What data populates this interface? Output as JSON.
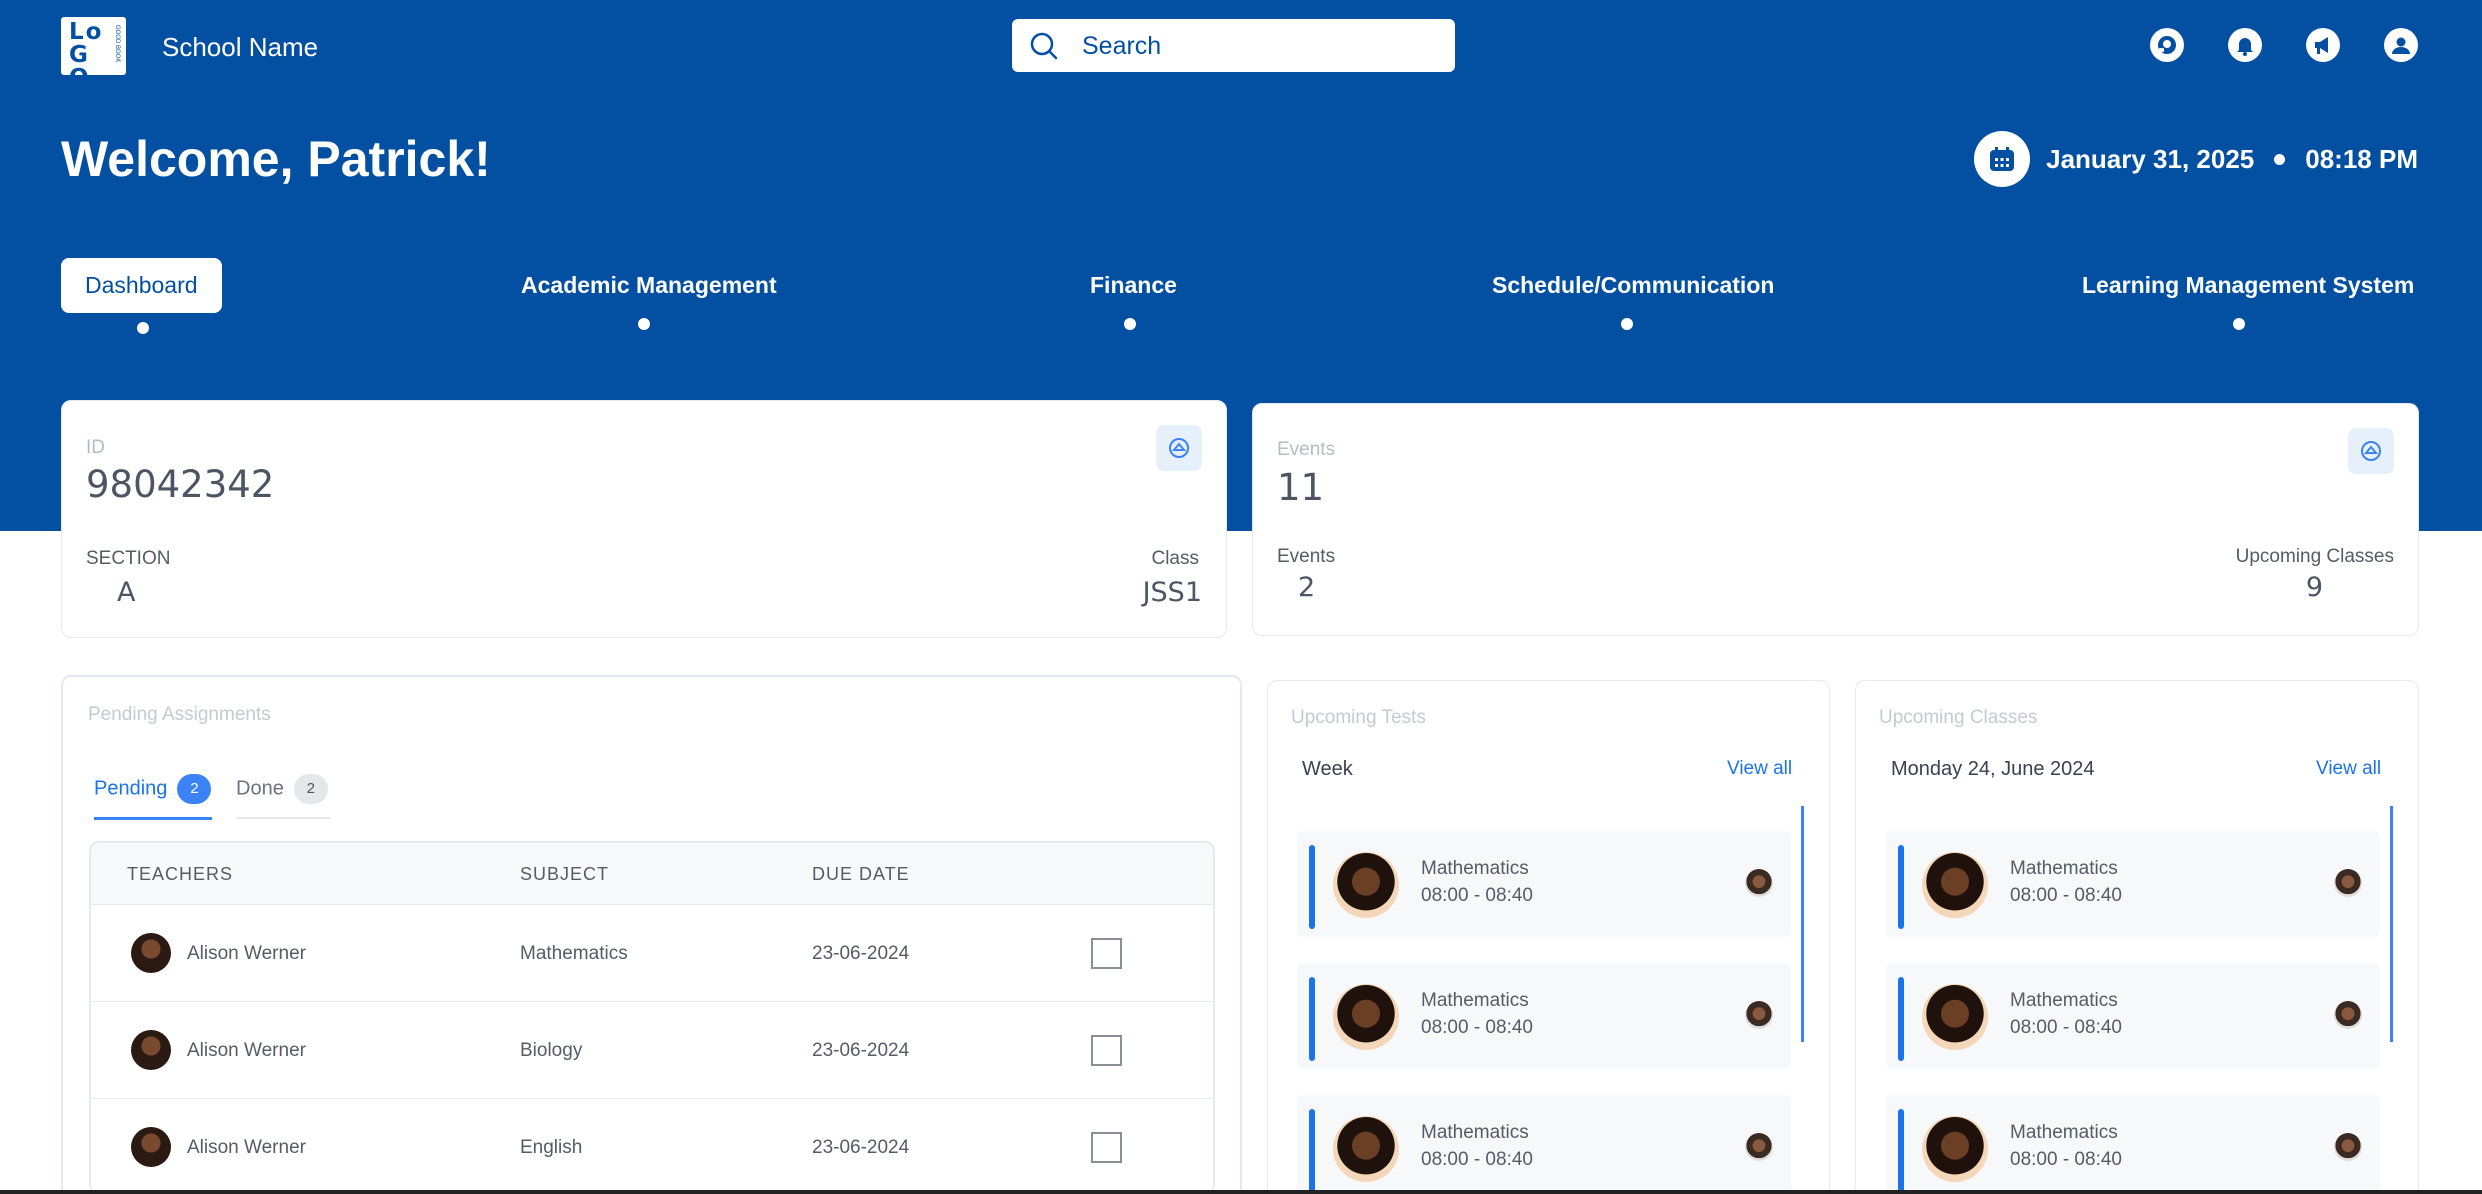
{
  "header": {
    "logo_text": "LoGO",
    "logo_subtext": "GOOD BOOK",
    "school_name": "School Name",
    "search_placeholder": "Search",
    "icons": [
      "support-icon",
      "bell-icon",
      "megaphone-icon",
      "user-icon"
    ]
  },
  "welcome": "Welcome, Patrick!",
  "date": "January 31, 2025",
  "time": "08:18 PM",
  "nav": {
    "items": [
      {
        "label": "Dashboard",
        "active": true
      },
      {
        "label": "Academic Management"
      },
      {
        "label": "Finance"
      },
      {
        "label": "Schedule/Communication"
      },
      {
        "label": "Learning Management System"
      }
    ]
  },
  "id_card": {
    "id_label": "ID",
    "id_value": "98042342",
    "section_label": "SECTION",
    "section_value": "A",
    "class_label": "Class",
    "class_value": "JSS1"
  },
  "events_card": {
    "events_label": "Events",
    "events_value": "11",
    "events2_label": "Events",
    "events2_value": "2",
    "upcoming_label": "Upcoming Classes",
    "upcoming_value": "9"
  },
  "assignments": {
    "title": "Pending Assignments",
    "tabs": [
      {
        "label": "Pending",
        "count": "2",
        "active": true
      },
      {
        "label": "Done",
        "count": "2"
      }
    ],
    "columns": [
      "TEACHERS",
      "SUBJECT",
      "DUE DATE"
    ],
    "rows": [
      {
        "teacher": "Alison Werner",
        "subject": "Mathematics",
        "due": "23-06-2024"
      },
      {
        "teacher": "Alison Werner",
        "subject": "Biology",
        "due": "23-06-2024"
      },
      {
        "teacher": "Alison Werner",
        "subject": "English",
        "due": "23-06-2024"
      }
    ]
  },
  "tests": {
    "title": "Upcoming Tests",
    "period": "Week",
    "view_all": "View all",
    "items": [
      {
        "subject": "Mathematics",
        "time": "08:00 - 08:40"
      },
      {
        "subject": "Mathematics",
        "time": "08:00 - 08:40"
      },
      {
        "subject": "Mathematics",
        "time": "08:00 - 08:40"
      }
    ]
  },
  "classes": {
    "title": "Upcoming Classes",
    "date": "Monday 24, June 2024",
    "view_all": "View all",
    "items": [
      {
        "subject": "Mathematics",
        "time": "08:00 - 08:40"
      },
      {
        "subject": "Mathematics",
        "time": "08:00 - 08:40"
      },
      {
        "subject": "Mathematics",
        "time": "08:00 - 08:40"
      }
    ]
  },
  "colors": {
    "brand": "#0350a3",
    "accent": "#1a73e8",
    "badge": "#3b82f6"
  }
}
